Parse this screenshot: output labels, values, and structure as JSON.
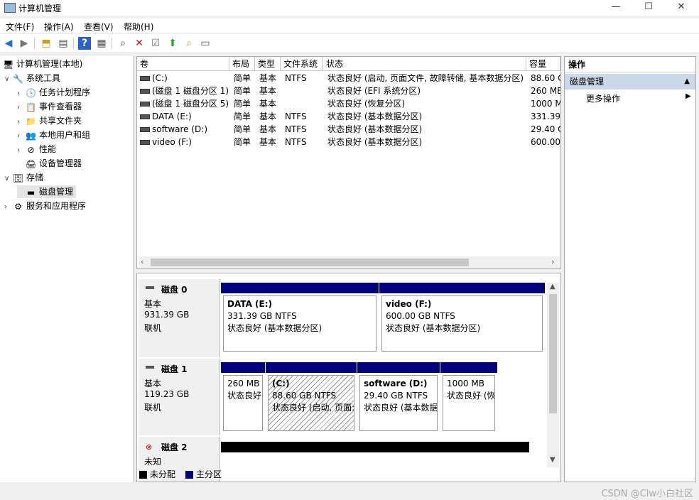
{
  "window": {
    "title": "计算机管理",
    "min": "—",
    "max": "☐",
    "close": "✕"
  },
  "menu": [
    "文件(F)",
    "操作(A)",
    "查看(V)",
    "帮助(H)"
  ],
  "tree": [
    {
      "label": "计算机管理(本地)",
      "exp": "",
      "icon": "🖥"
    },
    {
      "label": "系统工具",
      "exp": "∨",
      "icon": "🔧"
    },
    {
      "label": "任务计划程序",
      "exp": "›",
      "icon": "🕓"
    },
    {
      "label": "事件查看器",
      "exp": "›",
      "icon": "📋"
    },
    {
      "label": "共享文件夹",
      "exp": "›",
      "icon": "📁"
    },
    {
      "label": "本地用户和组",
      "exp": "›",
      "icon": "👥"
    },
    {
      "label": "性能",
      "exp": "›",
      "icon": "⊘"
    },
    {
      "label": "设备管理器",
      "exp": "",
      "icon": "🖨"
    },
    {
      "label": "存储",
      "exp": "∨",
      "icon": "🗄"
    },
    {
      "label": "磁盘管理",
      "exp": "",
      "icon": "▬"
    },
    {
      "label": "服务和应用程序",
      "exp": "›",
      "icon": "⚙"
    }
  ],
  "columns": [
    "卷",
    "布局",
    "类型",
    "文件系统",
    "状态",
    "容量"
  ],
  "volumes": [
    {
      "name": "(C:)",
      "layout": "简单",
      "type": "基本",
      "fs": "NTFS",
      "status": "状态良好 (启动, 页面文件, 故障转储, 基本数据分区)",
      "cap": "88.60 G"
    },
    {
      "name": "(磁盘 1 磁盘分区 1)",
      "layout": "简单",
      "type": "基本",
      "fs": "",
      "status": "状态良好 (EFI 系统分区)",
      "cap": "260 MB"
    },
    {
      "name": "(磁盘 1 磁盘分区 5)",
      "layout": "简单",
      "type": "基本",
      "fs": "",
      "status": "状态良好 (恢复分区)",
      "cap": "1000 M"
    },
    {
      "name": "DATA (E:)",
      "layout": "简单",
      "type": "基本",
      "fs": "NTFS",
      "status": "状态良好 (基本数据分区)",
      "cap": "331.39"
    },
    {
      "name": "software (D:)",
      "layout": "简单",
      "type": "基本",
      "fs": "NTFS",
      "status": "状态良好 (基本数据分区)",
      "cap": "29.40 G"
    },
    {
      "name": "video (F:)",
      "layout": "简单",
      "type": "基本",
      "fs": "NTFS",
      "status": "状态良好 (基本数据分区)",
      "cap": "600.00"
    }
  ],
  "disks": [
    {
      "name": "磁盘 0",
      "kind": "基本",
      "size": "931.39 GB",
      "state": "联机"
    },
    {
      "name": "磁盘 1",
      "kind": "基本",
      "size": "119.23 GB",
      "state": "联机"
    },
    {
      "name": "磁盘 2",
      "kind": "未知",
      "size": "",
      "state": ""
    }
  ],
  "parts": {
    "d0p0": {
      "title": "DATA  (E:)",
      "size": "331.39 GB NTFS",
      "status": "状态良好 (基本数据分区)"
    },
    "d0p1": {
      "title": "video  (F:)",
      "size": "600.00 GB NTFS",
      "status": "状态良好 (基本数据分区)"
    },
    "d1p0": {
      "title": "",
      "size": "260 MB",
      "status": "状态良好"
    },
    "d1p1": {
      "title": "(C:)",
      "size": "88.60 GB NTFS",
      "status": "状态良好 (启动, 页面:"
    },
    "d1p2": {
      "title": "software  (D:)",
      "size": "29.40 GB NTFS",
      "status": "状态良好 (基本数据"
    },
    "d1p3": {
      "title": "",
      "size": "1000 MB",
      "status": "状态良好 (恢"
    }
  },
  "legend": {
    "unalloc": "未分配",
    "primary": "主分区"
  },
  "actions": {
    "header": "操作",
    "section": "磁盘管理",
    "more": "更多操作",
    "section_arrow": "▲",
    "more_arrow": "▶"
  },
  "watermark": "CSDN @Clw小白社区",
  "colors": {
    "primary": "#000080",
    "unallocated": "#000000"
  }
}
